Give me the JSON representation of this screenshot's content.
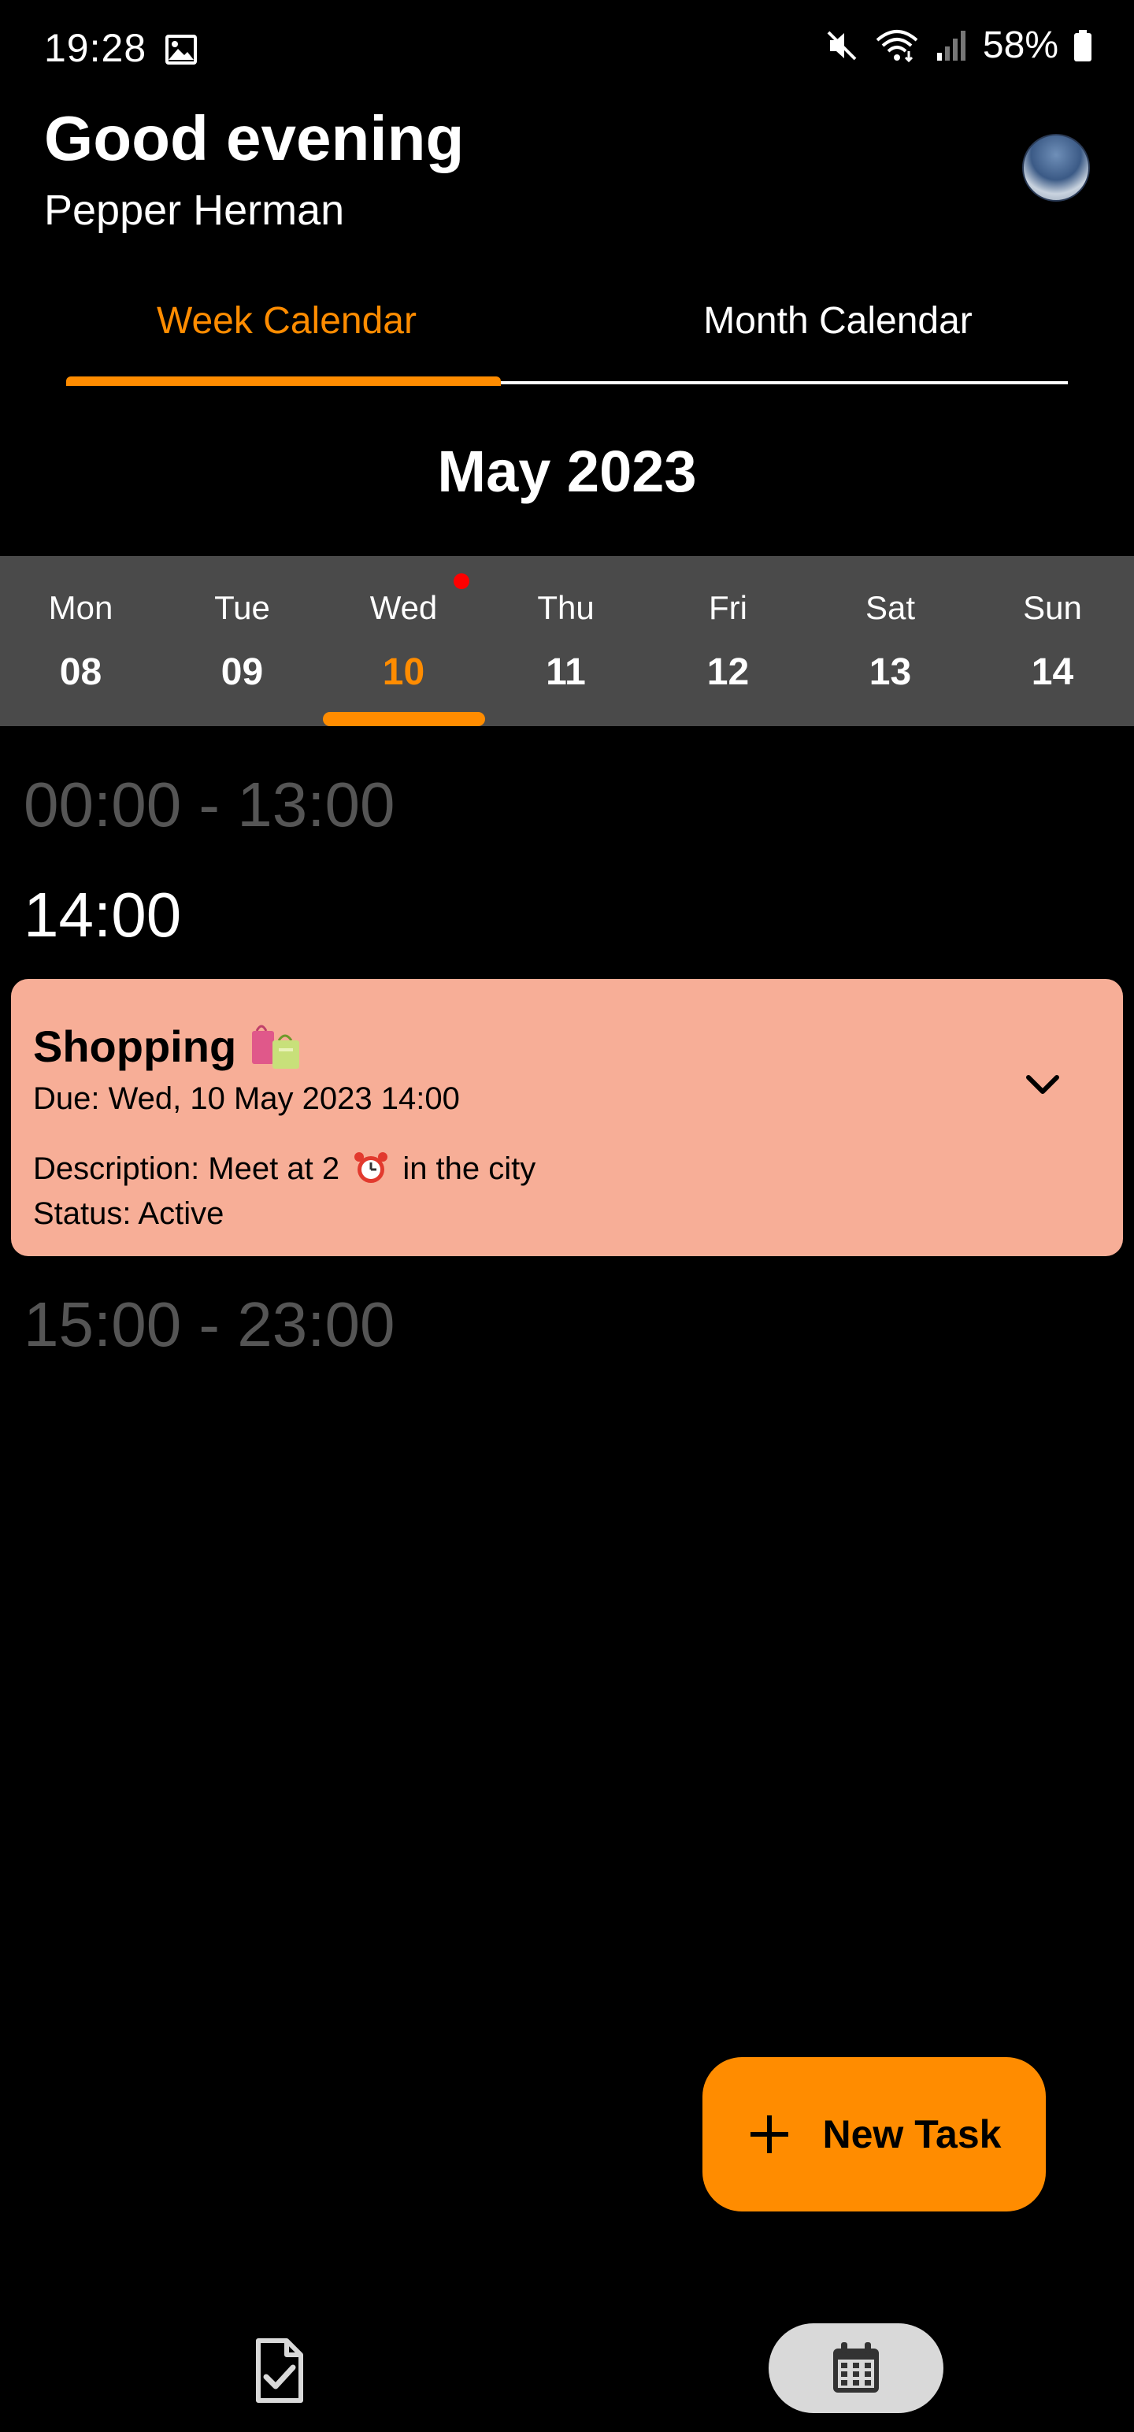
{
  "status_bar": {
    "time": "19:28",
    "battery_percent": "58%",
    "icons": [
      "image-icon",
      "mute-icon",
      "wifi-icon",
      "signal-icon",
      "battery-icon"
    ]
  },
  "header": {
    "greeting": "Good evening",
    "username": "Pepper Herman"
  },
  "tabs": [
    {
      "label": "Week Calendar",
      "selected": true
    },
    {
      "label": "Month Calendar",
      "selected": false
    }
  ],
  "calendar": {
    "month_title": "May 2023",
    "days": [
      {
        "name": "Mon",
        "num": "08"
      },
      {
        "name": "Tue",
        "num": "09"
      },
      {
        "name": "Wed",
        "num": "10",
        "selected": true,
        "has_event": true
      },
      {
        "name": "Thu",
        "num": "11"
      },
      {
        "name": "Fri",
        "num": "12"
      },
      {
        "name": "Sat",
        "num": "13"
      },
      {
        "name": "Sun",
        "num": "14"
      }
    ]
  },
  "schedule": {
    "range_before": "00:00 - 13:00",
    "current_hour": "14:00",
    "range_after": "15:00 - 23:00"
  },
  "task": {
    "title": "Shopping",
    "due": "Due: Wed, 10 May 2023 14:00",
    "description_prefix": "Description: Meet at 2",
    "description_suffix": "in the city",
    "status": "Status: Active",
    "card_color": "#f7ae97"
  },
  "fab": {
    "label": "New Task"
  },
  "colors": {
    "accent": "#ff8c00",
    "strip": "#4a4a4a",
    "muted_text": "#555555"
  },
  "bottom_nav": {
    "items": [
      {
        "icon": "task-list-icon",
        "selected": false
      },
      {
        "icon": "calendar-icon",
        "selected": true
      }
    ]
  }
}
